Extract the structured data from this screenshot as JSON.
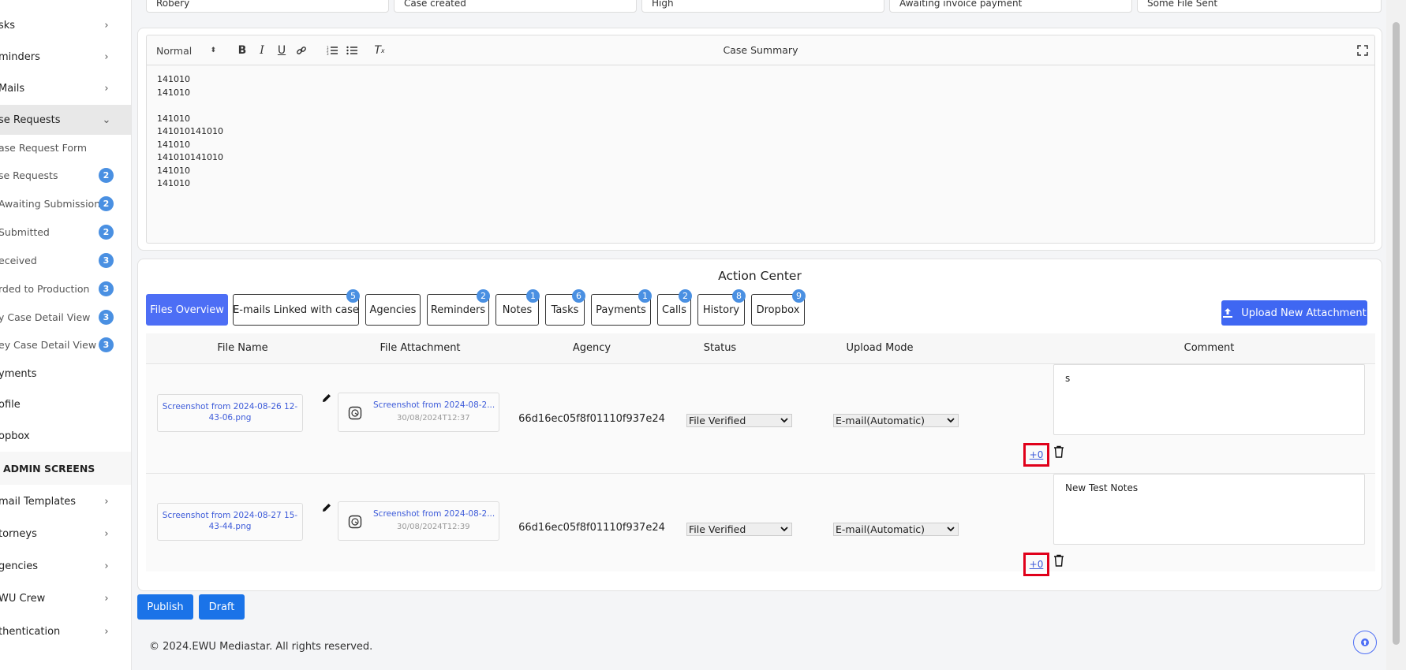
{
  "sidebar": {
    "items": [
      {
        "label": "sks",
        "chevron": "chevron-right"
      },
      {
        "label": "minders",
        "chevron": "chevron-right"
      },
      {
        "label": "Mails",
        "chevron": "chevron-right"
      },
      {
        "label": "se Requests",
        "chevron": "chevron-down",
        "active": true
      }
    ],
    "subitems": [
      {
        "label": "ase Request Form",
        "badge": ""
      },
      {
        "label": "se Requests",
        "badge": "2"
      },
      {
        "label": "Awaiting Submission",
        "badge": "2"
      },
      {
        "label": "Submitted",
        "badge": "2"
      },
      {
        "label": "eceived",
        "badge": "3"
      },
      {
        "label": "rded to Production",
        "badge": "3"
      },
      {
        "label": "y Case Detail View",
        "badge": "3"
      },
      {
        "label": "ey Case Detail View",
        "badge": "3"
      }
    ],
    "lower_items": [
      {
        "label": "yments"
      },
      {
        "label": "ofile"
      },
      {
        "label": "opbox"
      }
    ],
    "admin_heading": "ADMIN SCREENS",
    "admin_items": [
      {
        "label": "mail Templates"
      },
      {
        "label": "torneys"
      },
      {
        "label": "gencies"
      },
      {
        "label": "WU Crew"
      },
      {
        "label": "thentication"
      }
    ]
  },
  "top_fields": [
    "Robery",
    "Case created",
    "High",
    "Awaiting invoice payment",
    "Some File Sent"
  ],
  "editor": {
    "format_select": "Normal",
    "title": "Case Summary",
    "lines": [
      "141010",
      "141010",
      "",
      "141010",
      "141010141010",
      "141010",
      "141010141010",
      "141010",
      "141010"
    ]
  },
  "action_center": {
    "title": "Action Center",
    "tabs": [
      {
        "label": "Files Overview",
        "badge": "",
        "active": true
      },
      {
        "label": "E-mails Linked with case",
        "badge": "5"
      },
      {
        "label": "Agencies",
        "badge": ""
      },
      {
        "label": "Reminders",
        "badge": "2"
      },
      {
        "label": "Notes",
        "badge": "1"
      },
      {
        "label": "Tasks",
        "badge": "6"
      },
      {
        "label": "Payments",
        "badge": "1"
      },
      {
        "label": "Calls",
        "badge": "2"
      },
      {
        "label": "History",
        "badge": "8"
      },
      {
        "label": "Dropbox",
        "badge": "9"
      }
    ],
    "upload_label": "Upload New Attachment",
    "columns": [
      "File Name",
      "File Attachment",
      "Agency",
      "Status",
      "Upload Mode",
      "Comment"
    ],
    "rows": [
      {
        "file_name": "Screenshot from 2024-08-26 12-43-06.png",
        "attachment_name": "Screenshot from 2024-08-2...",
        "attachment_date": "30/08/2024T12:37",
        "agency": "66d16ec05f8f01110f937e24",
        "status": "File Verified",
        "upload_mode": "E-mail(Automatic)",
        "comment": "s",
        "plus_label": "+0"
      },
      {
        "file_name": "Screenshot from 2024-08-27 15-43-44.png",
        "attachment_name": "Screenshot from 2024-08-2...",
        "attachment_date": "30/08/2024T12:39",
        "agency": "66d16ec05f8f01110f937e24",
        "status": "File Verified",
        "upload_mode": "E-mail(Automatic)",
        "comment": "New Test Notes",
        "plus_label": "+0"
      }
    ]
  },
  "buttons": {
    "publish": "Publish",
    "draft": "Draft"
  },
  "footer": "© 2024.EWU Mediastar. All rights reserved.",
  "colors": {
    "accent": "#3f67f2",
    "badge": "#4a90e2",
    "highlight": "#e0001a"
  }
}
